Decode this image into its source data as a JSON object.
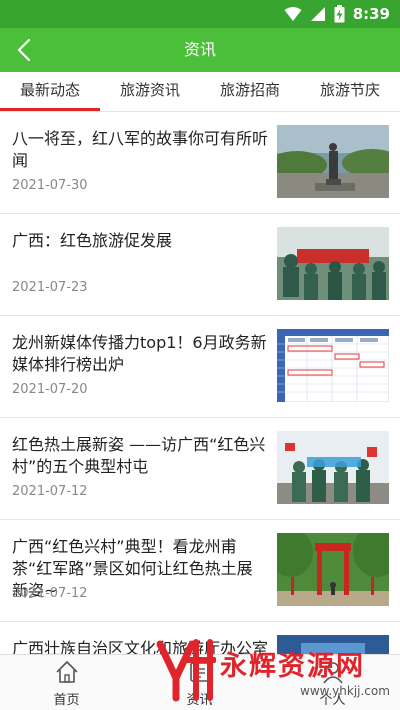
{
  "status_bar": {
    "time": "8:39"
  },
  "app_bar": {
    "title": "资讯"
  },
  "tabs": [
    {
      "label": "最新动态",
      "active": true
    },
    {
      "label": "旅游资讯",
      "active": false
    },
    {
      "label": "旅游招商",
      "active": false
    },
    {
      "label": "旅游节庆",
      "active": false
    }
  ],
  "news": [
    {
      "title": "八一将至，红八军的故事你可有所听闻",
      "date": "2021-07-30"
    },
    {
      "title": "广西：红色旅游促发展",
      "date": "2021-07-23"
    },
    {
      "title": "龙州新媒体传播力top1！6月政务新媒体排行榜出炉",
      "date": "2021-07-20"
    },
    {
      "title": "红色热土展新姿 ——访广西“红色兴村”的五个典型村屯",
      "date": "2021-07-12"
    },
    {
      "title": "广西“红色兴村”典型！看龙州甫茶“红军路”景区如何让红色热土展新姿~",
      "date": "2021-07-12"
    },
    {
      "title": "广西壮族自治区文化和旅游厅办公室",
      "date": ""
    }
  ],
  "bottom_nav": [
    {
      "label": "首页",
      "icon": "home-icon"
    },
    {
      "label": "资讯",
      "icon": "news-icon"
    },
    {
      "label": "个人",
      "icon": "user-icon"
    }
  ],
  "watermark": {
    "text": "永辉资源网",
    "url": "www.yhkjj.com"
  },
  "colors": {
    "status_bar": "#37a52f",
    "app_bar": "#4bbe3a",
    "tab_indicator": "#e02727",
    "watermark": "#e0242c"
  }
}
